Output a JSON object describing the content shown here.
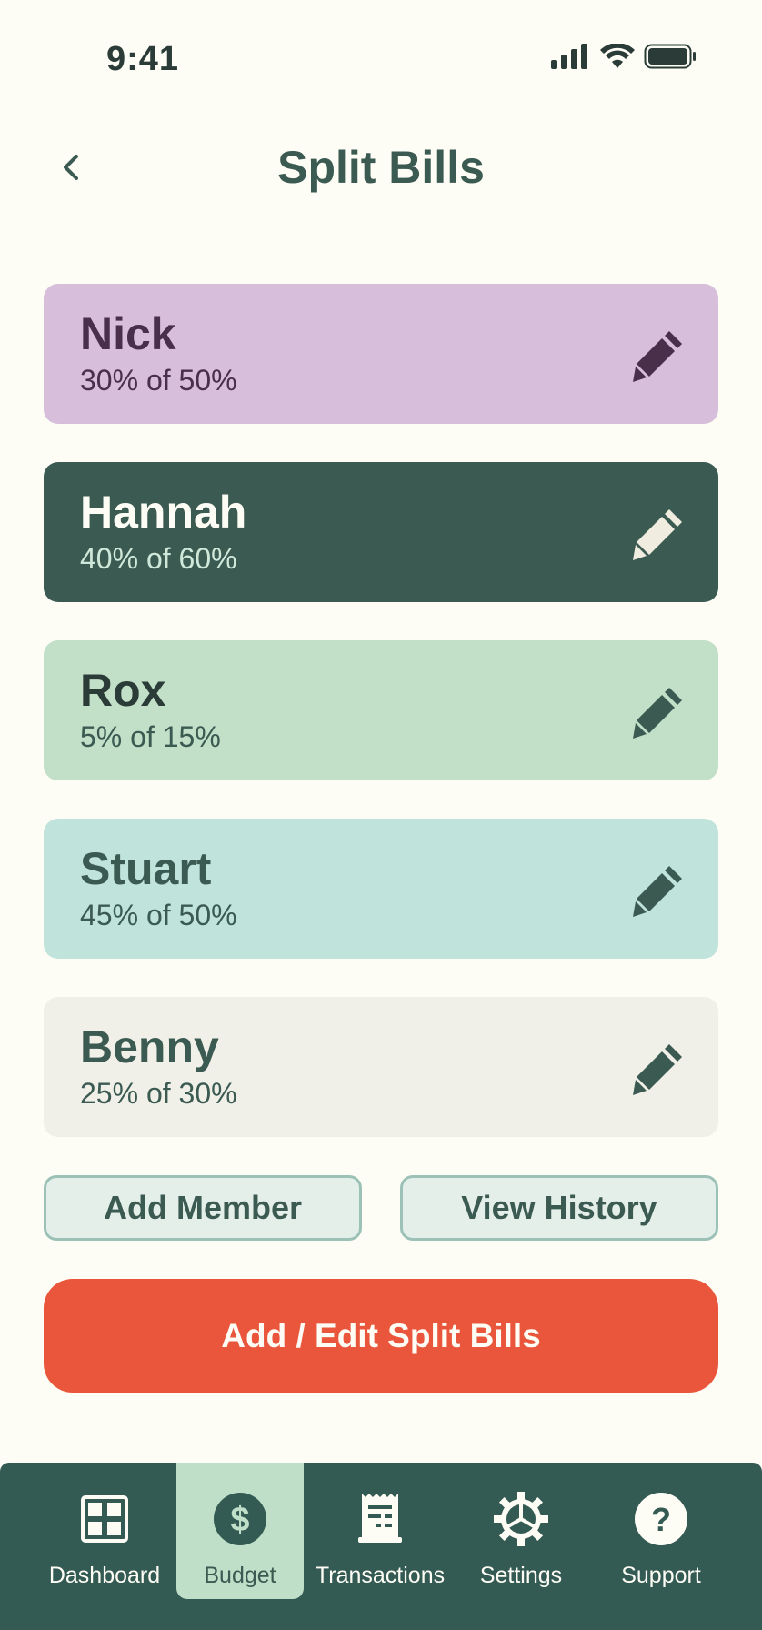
{
  "status_bar": {
    "time": "9:41",
    "icons": [
      "cellular-signal-icon",
      "wifi-icon",
      "battery-icon"
    ]
  },
  "header": {
    "title": "Split Bills",
    "back_icon": "chevron-left-icon"
  },
  "members": [
    {
      "name": "Nick",
      "share": "30% of 50%",
      "bg": "#d7bedb",
      "name_color": "#4a2f4a",
      "share_color": "#4a2f4a",
      "icon_color": "#4a2f4a"
    },
    {
      "name": "Hannah",
      "share": "40% of 60%",
      "bg": "#3b5a52",
      "name_color": "#fdfdf5",
      "share_color": "#cfe8da",
      "icon_color": "#f0ede0"
    },
    {
      "name": "Rox",
      "share": "5% of 15%",
      "bg": "#c2dfc8",
      "name_color": "#2b3b37",
      "share_color": "#3b5a52",
      "icon_color": "#3b5a52"
    },
    {
      "name": "Stuart",
      "share": "45% of 50%",
      "bg": "#c0e3dc",
      "name_color": "#3b5a52",
      "share_color": "#3b5a52",
      "icon_color": "#3b5a52"
    },
    {
      "name": "Benny",
      "share": "25% of 30%",
      "bg": "#f0f0e8",
      "name_color": "#3b5a52",
      "share_color": "#3b5a52",
      "icon_color": "#3b5a52"
    }
  ],
  "actions": {
    "add_member": "Add Member",
    "view_history": "View History",
    "primary": "Add / Edit Split Bills"
  },
  "nav": {
    "items": [
      {
        "label": "Dashboard",
        "icon": "dashboard-grid-icon"
      },
      {
        "label": "Budget",
        "icon": "dollar-icon",
        "active": true
      },
      {
        "label": "Transactions",
        "icon": "receipt-icon"
      },
      {
        "label": "Settings",
        "icon": "gear-icon"
      },
      {
        "label": "Support",
        "icon": "help-icon"
      }
    ]
  },
  "colors": {
    "background": "#fdfdf5",
    "primary_text": "#3b5a52",
    "accent": "#ea563c",
    "nav_bg": "#335a53",
    "nav_active": "#bfdfc8"
  }
}
